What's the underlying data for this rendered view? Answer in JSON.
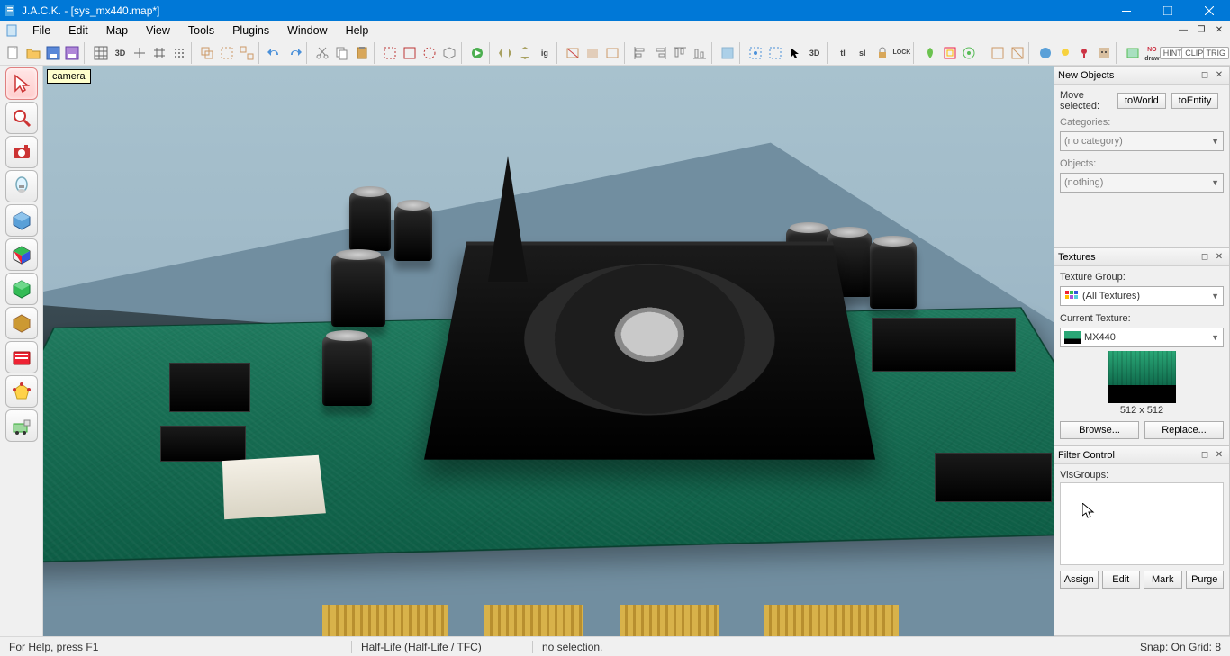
{
  "title": "J.A.C.K. - [sys_mx440.map*]",
  "menu": [
    "File",
    "Edit",
    "Map",
    "View",
    "Tools",
    "Plugins",
    "Window",
    "Help"
  ],
  "tooltip": "camera",
  "topbar_text_items": {
    "3d": "3D",
    "ig": "ig",
    "tl": "tl",
    "sl": "sl",
    "lock": "LOCK",
    "no": "NO",
    "draw": "draw",
    "hint": "HINT",
    "clip": "CLIP",
    "trig": "TRIG"
  },
  "panels": {
    "newObjects": {
      "title": "New Objects",
      "moveSelected": "Move selected:",
      "toWorld": "toWorld",
      "toEntity": "toEntity",
      "categoriesLabel": "Categories:",
      "categoriesValue": "(no category)",
      "objectsLabel": "Objects:",
      "objectsValue": "(nothing)"
    },
    "textures": {
      "title": "Textures",
      "groupLabel": "Texture Group:",
      "groupValue": "(All Textures)",
      "currentLabel": "Current Texture:",
      "currentValue": "MX440",
      "size": "512 x 512",
      "browse": "Browse...",
      "replace": "Replace..."
    },
    "filter": {
      "title": "Filter Control",
      "visgroups": "VisGroups:",
      "assign": "Assign",
      "edit": "Edit",
      "mark": "Mark",
      "purge": "Purge"
    }
  },
  "status": {
    "help": "For Help, press F1",
    "game": "Half-Life (Half-Life / TFC)",
    "sel": "no selection.",
    "snap": "Snap: On Grid: 8"
  }
}
